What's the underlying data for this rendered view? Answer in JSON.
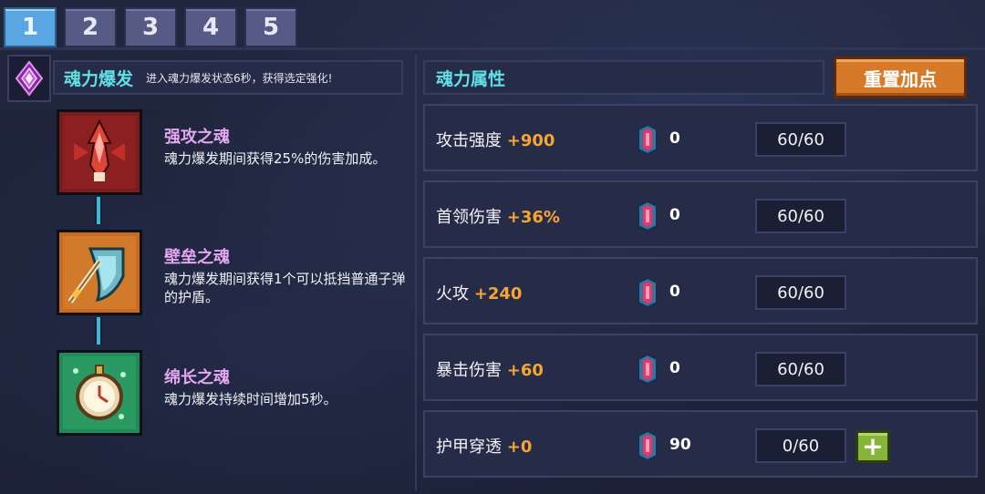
{
  "tabs": [
    "1",
    "2",
    "3",
    "4",
    "5"
  ],
  "active_tab": 0,
  "burst": {
    "title": "魂力爆发",
    "description": "进入魂力爆发状态6秒，获得选定强化!",
    "icon": "purple-diamond-icon"
  },
  "skills": [
    {
      "name": "强攻之魂",
      "desc": "魂力爆发期间获得25%的伤害加成。",
      "icon": "red-blade-icon"
    },
    {
      "name": "壁垒之魂",
      "desc": "魂力爆发期间获得1个可以抵挡普通子弹的护盾。",
      "icon": "shield-sword-icon"
    },
    {
      "name": "绵长之魂",
      "desc": "魂力爆发持续时间增加5秒。",
      "icon": "stopwatch-icon"
    }
  ],
  "attributes_title": "魂力属性",
  "reset_label": "重置加点",
  "attributes": [
    {
      "label": "攻击强度",
      "bonus": "+900",
      "gems": "0",
      "level": "60/60",
      "can_add": false
    },
    {
      "label": "首领伤害",
      "bonus": "+36%",
      "gems": "0",
      "level": "60/60",
      "can_add": false
    },
    {
      "label": "火攻",
      "bonus": "+240",
      "gems": "0",
      "level": "60/60",
      "can_add": false
    },
    {
      "label": "暴击伤害",
      "bonus": "+60",
      "gems": "0",
      "level": "60/60",
      "can_add": false
    },
    {
      "label": "护甲穿透",
      "bonus": "+0",
      "gems": "90",
      "level": "0/60",
      "can_add": true
    }
  ],
  "colors": {
    "accent_cyan": "#5fe0e6",
    "bonus_orange": "#f5a532",
    "skill_name": "#e4a6f0",
    "reset_button": "#d67a2a",
    "plus_button": "#86b53a",
    "active_tab": "#5aa6e2"
  }
}
